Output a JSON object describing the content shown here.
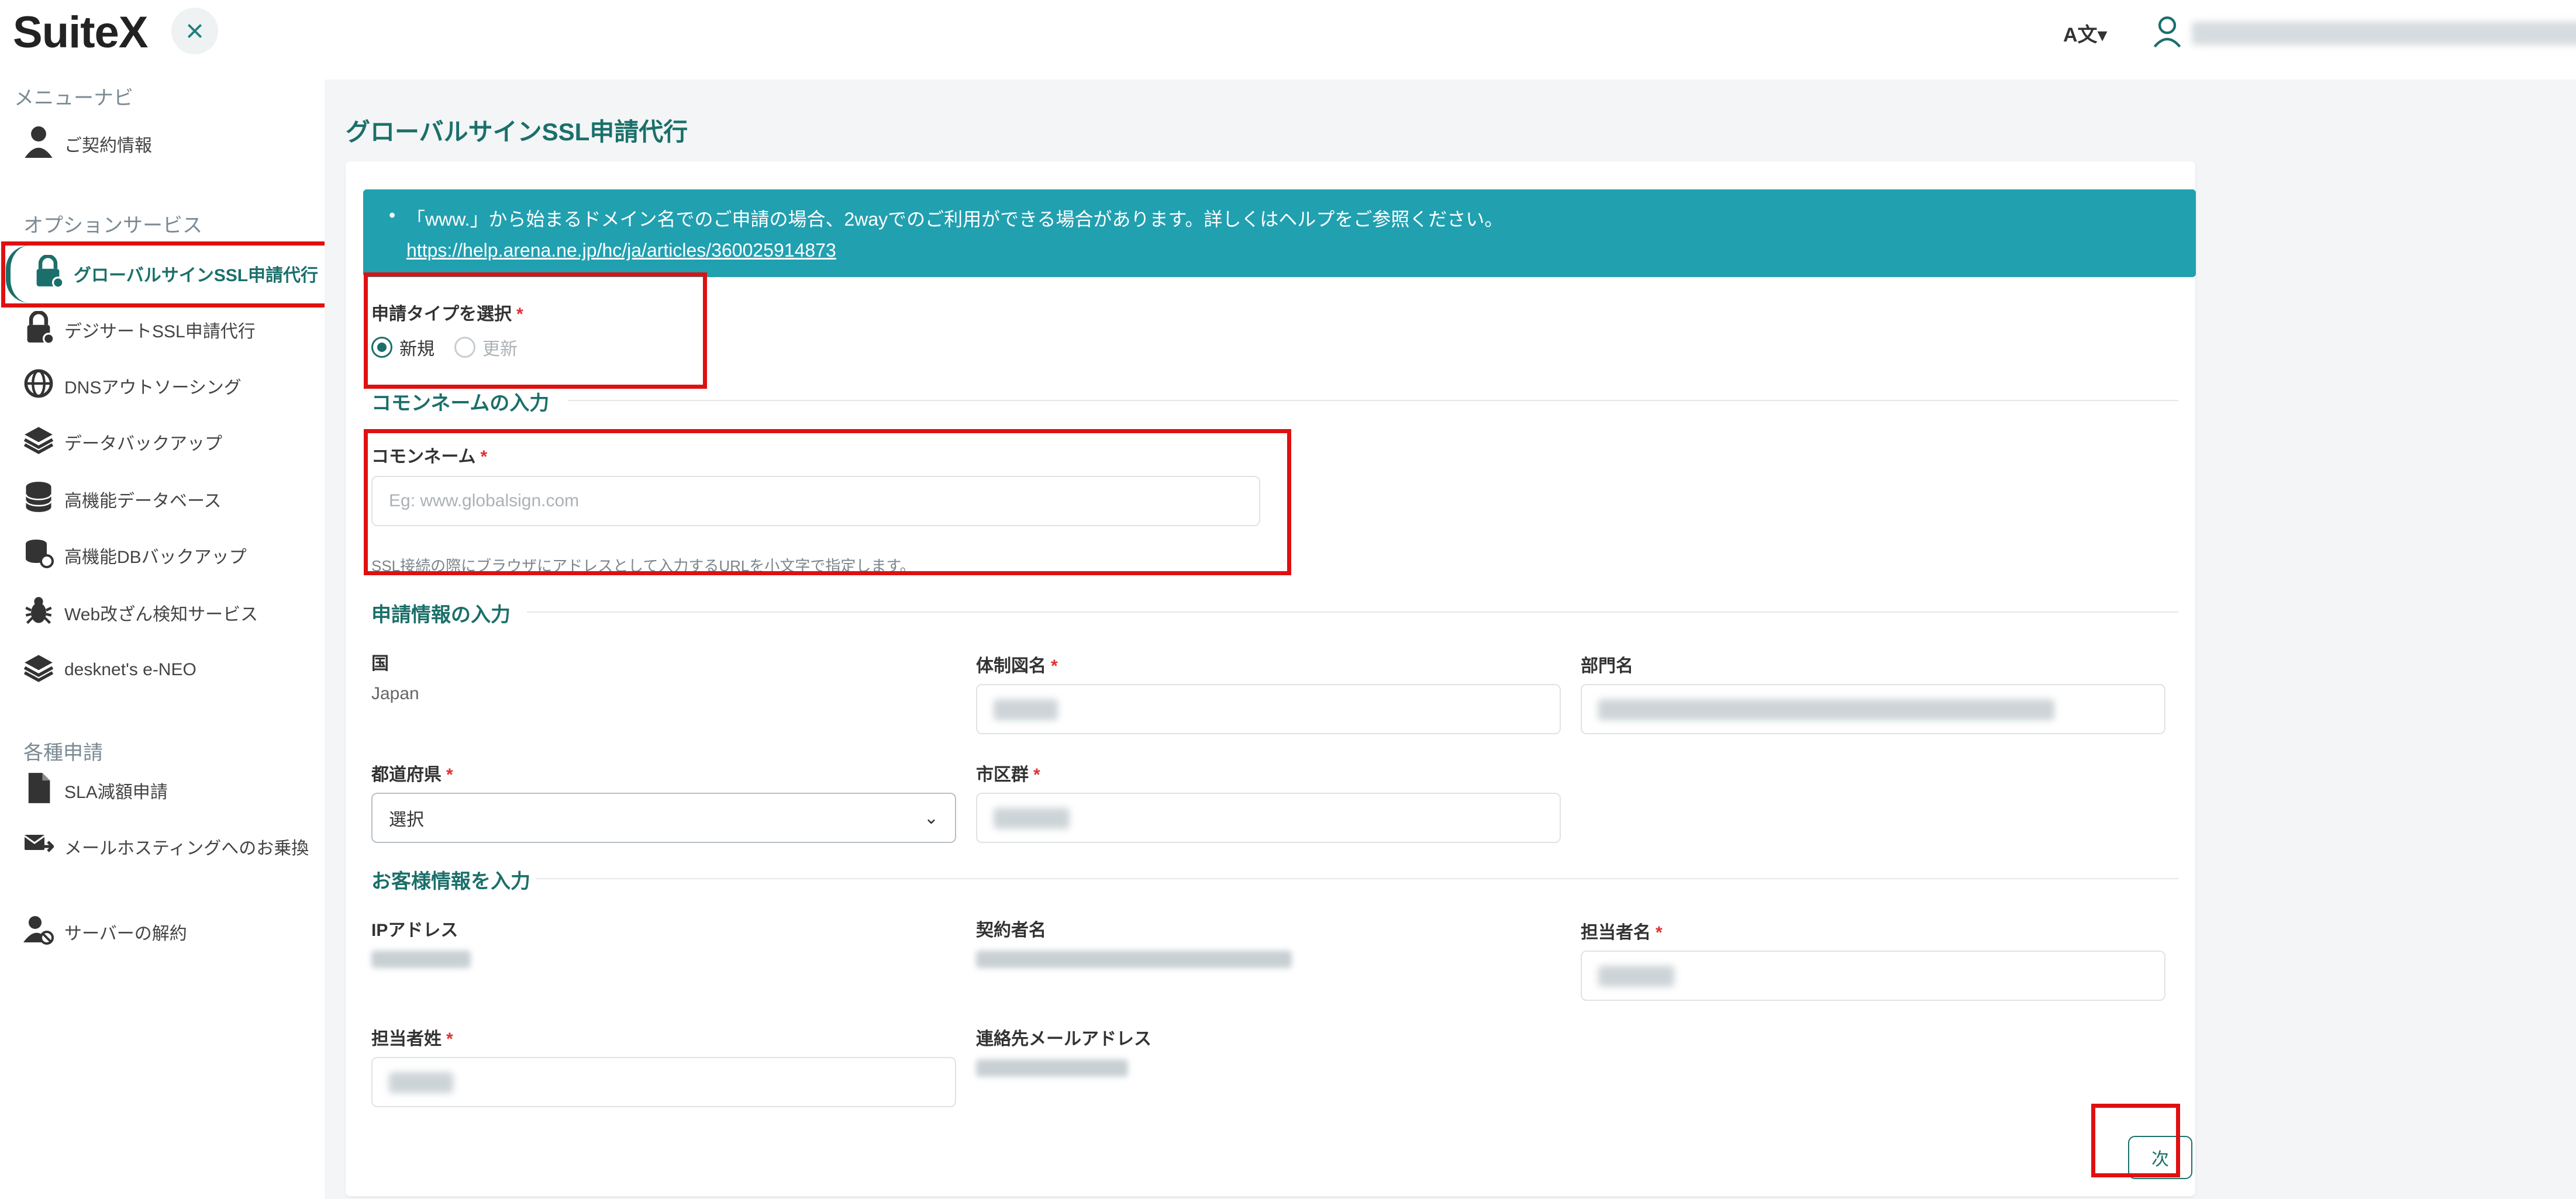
{
  "header": {
    "logo": "SuiteX",
    "close_icon": "×",
    "lang_label": "A文▾"
  },
  "sidebar": {
    "section_menu": "メニューナビ",
    "section_options": "オプションサービス",
    "section_apply": "各種申請",
    "items": [
      {
        "label": "ご契約情報",
        "icon": "user-icon"
      },
      {
        "label": "グローバルサインSSL申請代行",
        "icon": "lock-icon"
      },
      {
        "label": "デジサートSSL申請代行",
        "icon": "lock-icon"
      },
      {
        "label": "DNSアウトソーシング",
        "icon": "globe-icon"
      },
      {
        "label": "データバックアップ",
        "icon": "layers-icon"
      },
      {
        "label": "高機能データベース",
        "icon": "database-icon"
      },
      {
        "label": "高機能DBバックアップ",
        "icon": "database-backup-icon"
      },
      {
        "label": "Web改ざん検知サービス",
        "icon": "bug-icon"
      },
      {
        "label": "desknet's e-NEO",
        "icon": "layers-icon"
      },
      {
        "label": "SLA減額申請",
        "icon": "document-icon"
      },
      {
        "label": "メールホスティングへのお乗換",
        "icon": "mail-transfer-icon"
      },
      {
        "label": "サーバーの解約",
        "icon": "user-cancel-icon"
      }
    ]
  },
  "main": {
    "page_title": "グローバルサインSSL申請代行",
    "notice": {
      "text": "「www.」から始まるドメイン名でのご申請の場合、2wayでのご利用ができる場合があります。詳しくはヘルプをご参照ください。",
      "link": "https://help.arena.ne.jp/hc/ja/articles/360025914873"
    },
    "apply_type": {
      "label": "申請タイプを選択",
      "required": "*",
      "options": [
        {
          "label": "新規",
          "selected": true
        },
        {
          "label": "更新",
          "selected": false,
          "disabled": true
        }
      ]
    },
    "common_name_section": "コモンネームの入力",
    "common_name": {
      "label": "コモンネーム",
      "required": "*",
      "placeholder": "Eg: www.globalsign.com",
      "hint": "SSL接続の際にブラウザにアドレスとして入力するURLを小文字で指定します。"
    },
    "application_section": "申請情報の入力",
    "country": {
      "label": "国",
      "value": "Japan"
    },
    "organization": {
      "label": "体制図名",
      "required": "*",
      "value": ""
    },
    "department": {
      "label": "部門名",
      "value": ""
    },
    "prefecture": {
      "label": "都道府県",
      "required": "*",
      "value": "選択"
    },
    "city": {
      "label": "市区群",
      "required": "*",
      "value": ""
    },
    "customer_section": "お客様情報を入力",
    "ip_address": {
      "label": "IPアドレス",
      "value": ""
    },
    "contractor": {
      "label": "契約者名",
      "value": ""
    },
    "contact_first": {
      "label": "担当者名",
      "required": "*",
      "value": ""
    },
    "contact_last": {
      "label": "担当者姓",
      "required": "*",
      "value": ""
    },
    "contact_email": {
      "label": "連絡先メールアドレス",
      "value": ""
    },
    "next_button": "次"
  },
  "colors": {
    "accent": "#1b6f6a",
    "notice_bg": "#21a0b0",
    "highlight": "#e01010",
    "required": "#e03030"
  }
}
